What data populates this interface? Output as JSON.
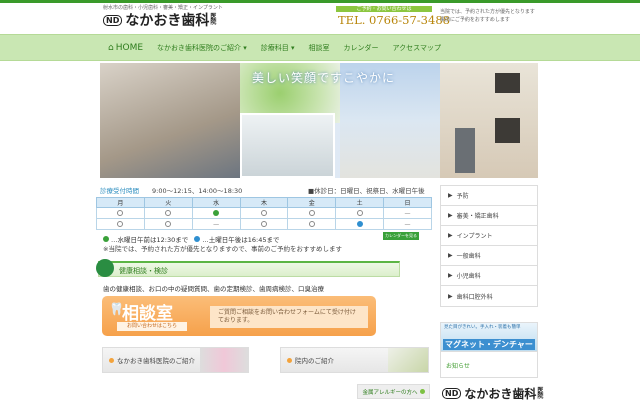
{
  "header": {
    "tagline": "射水市の歯科・小児歯科・審美・矯正・インプラント",
    "logo_mark": "ND",
    "logo_name": "なかおき歯科",
    "logo_suffix": "医院",
    "tel_label": "ご予約・お問い合わせは",
    "tel": "TEL. 0766-57-3488",
    "note": "当院では、予約された方が優先となります 事前にご予約をおすすめします"
  },
  "nav": {
    "home": "HOME",
    "items": [
      "なかおき歯科医院のご紹介 ▾",
      "診療科目 ▾",
      "相談室",
      "カレンダー",
      "アクセスマップ"
    ]
  },
  "hero": {
    "slogan": "美しい笑顔ですこやかに"
  },
  "hours": {
    "label": "診療受付時間",
    "value": "9:00～12:15、14:00～18:30",
    "closed": "■休診日：日曜日、祝祭日、水曜日午後"
  },
  "schedule": {
    "days": [
      "月",
      "火",
      "水",
      "木",
      "金",
      "土",
      "日"
    ],
    "rows": [
      [
        "circle",
        "circle",
        "green",
        "circle",
        "circle",
        "circle",
        "—"
      ],
      [
        "circle",
        "circle",
        "—",
        "circle",
        "circle",
        "blue",
        "—"
      ]
    ]
  },
  "legend": {
    "green": "…水曜日午前は12:30まで",
    "blue": "…土曜日午後は16:45まで",
    "calendar_btn": "カレンダーを見る",
    "notice": "※当院では、予約された方が優先となりますので、事前のご予約をおすすめします"
  },
  "colors": {
    "green": "#3aa13a",
    "blue": "#2f8fd0"
  },
  "section": {
    "title": "健康相談・検診",
    "text": "歯の健康相談、お口の中の疑問質問、歯の定期検診、歯周病検診、口臭治療"
  },
  "consult": {
    "title": "相談室",
    "sub": "お問い合わせはこちら",
    "msg": "ご質問ご相談をお問い合わせフォームにて受け付けております。"
  },
  "boxes": [
    "なかおき歯科医院のご紹介",
    "院内のご紹介"
  ],
  "allergy": "金属アレルギーの方へ",
  "sidebar": {
    "items": [
      "予防",
      "審美・矯正歯科",
      "インプラント",
      "一般歯科",
      "小児歯科",
      "歯科口腔外科"
    ],
    "magnet_a": "見た目がきれい。手入れ・装着も簡単",
    "magnet_b": "マグネット・デンチャー",
    "news": "お知らせ"
  }
}
